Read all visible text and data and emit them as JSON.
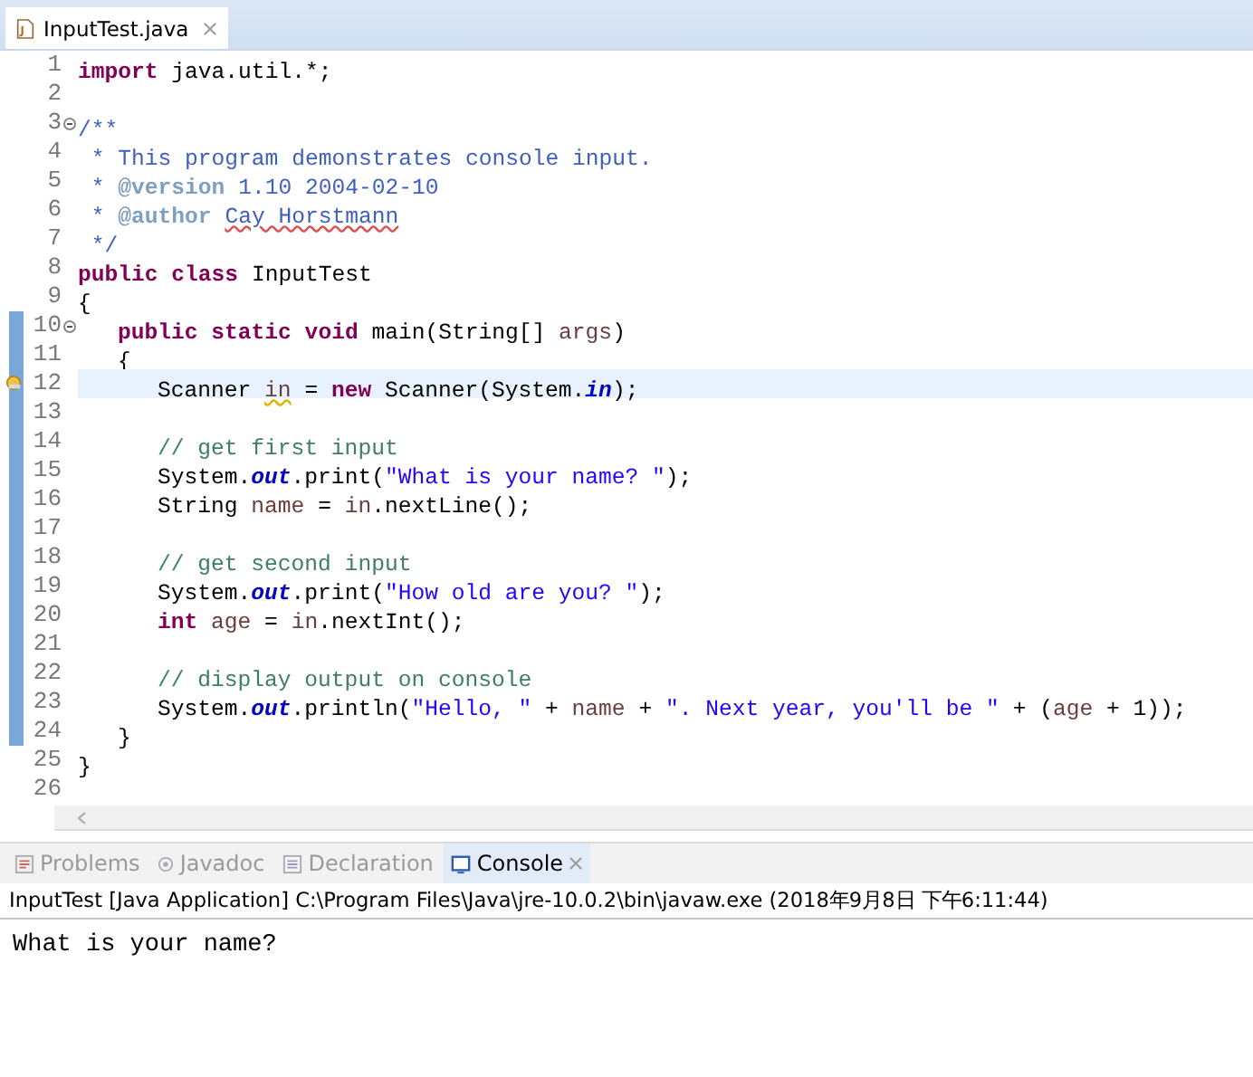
{
  "editor": {
    "tabs": [
      {
        "label": "InputTest.java",
        "selected": true
      }
    ],
    "lines": [
      {
        "number": "1",
        "fold": false,
        "range": false,
        "current": false,
        "warning": false,
        "tokens": [
          {
            "kind": "keyword",
            "text": "import"
          },
          {
            "kind": "plain",
            "text": " java.util.*;"
          }
        ]
      },
      {
        "number": "2",
        "fold": false,
        "range": false,
        "current": false,
        "warning": false
      },
      {
        "number": "3",
        "fold": true,
        "range": false,
        "current": false,
        "warning": false,
        "tokens": [
          {
            "kind": "doc",
            "text": "/**"
          }
        ]
      },
      {
        "number": "4",
        "fold": false,
        "range": false,
        "current": false,
        "warning": false,
        "tokens": [
          {
            "kind": "doc",
            "text": " * This program demonstrates console input."
          }
        ]
      },
      {
        "number": "5",
        "fold": false,
        "range": false,
        "current": false,
        "warning": false,
        "tokens": [
          {
            "kind": "doc",
            "text": " * "
          },
          {
            "kind": "doctag",
            "text": "@version"
          },
          {
            "kind": "doc",
            "text": " 1.10 2004-02-10"
          }
        ]
      },
      {
        "number": "6",
        "fold": false,
        "range": false,
        "current": false,
        "warning": false,
        "tokens": [
          {
            "kind": "doc",
            "text": " * "
          },
          {
            "kind": "doctag",
            "text": "@author "
          },
          {
            "kind": "doc_misspelled",
            "text": "Cay Horstmann"
          }
        ]
      },
      {
        "number": "7",
        "fold": false,
        "range": false,
        "current": false,
        "warning": false,
        "tokens": [
          {
            "kind": "doc",
            "text": " */"
          }
        ]
      },
      {
        "number": "8",
        "fold": false,
        "range": false,
        "current": false,
        "warning": false,
        "tokens": [
          {
            "kind": "keyword",
            "text": "public class"
          },
          {
            "kind": "plain",
            "text": " InputTest"
          }
        ]
      },
      {
        "number": "9",
        "fold": false,
        "range": false,
        "current": false,
        "warning": false,
        "tokens": [
          {
            "kind": "plain",
            "text": "{"
          }
        ]
      },
      {
        "number": "10",
        "fold": true,
        "range": true,
        "current": false,
        "warning": false,
        "tokens": [
          {
            "kind": "keyword",
            "text": "\tpublic static void"
          },
          {
            "kind": "plain",
            "text": " main(String[] "
          },
          {
            "kind": "local",
            "text": "args"
          },
          {
            "kind": "plain",
            "text": ")"
          }
        ]
      },
      {
        "number": "11",
        "fold": false,
        "range": true,
        "current": false,
        "warning": false,
        "tokens": [
          {
            "kind": "plain",
            "text": "\t{"
          }
        ]
      },
      {
        "number": "12",
        "fold": false,
        "range": true,
        "current": true,
        "warning": true,
        "tokens": [
          {
            "kind": "plain",
            "text": "\t\tScanner "
          },
          {
            "kind": "local_warning",
            "text": "in"
          },
          {
            "kind": "plain",
            "text": " = "
          },
          {
            "kind": "keyword",
            "text": "new"
          },
          {
            "kind": "plain",
            "text": " Scanner(System."
          },
          {
            "kind": "static",
            "text": "in"
          },
          {
            "kind": "plain",
            "text": ");"
          }
        ]
      },
      {
        "number": "13",
        "fold": false,
        "range": true,
        "current": false,
        "warning": false
      },
      {
        "number": "14",
        "fold": false,
        "range": true,
        "current": false,
        "warning": false,
        "tokens": [
          {
            "kind": "comment",
            "text": "\t\t// get first input"
          }
        ]
      },
      {
        "number": "15",
        "fold": false,
        "range": true,
        "current": false,
        "warning": false,
        "tokens": [
          {
            "kind": "plain",
            "text": "\t\tSystem."
          },
          {
            "kind": "static",
            "text": "out"
          },
          {
            "kind": "plain",
            "text": ".print("
          },
          {
            "kind": "string",
            "text": "\"What is your name? \""
          },
          {
            "kind": "plain",
            "text": ");"
          }
        ]
      },
      {
        "number": "16",
        "fold": false,
        "range": true,
        "current": false,
        "warning": false,
        "tokens": [
          {
            "kind": "plain",
            "text": "\t\tString "
          },
          {
            "kind": "local",
            "text": "name"
          },
          {
            "kind": "plain",
            "text": " = "
          },
          {
            "kind": "local",
            "text": "in"
          },
          {
            "kind": "plain",
            "text": ".nextLine();"
          }
        ]
      },
      {
        "number": "17",
        "fold": false,
        "range": true,
        "current": false,
        "warning": false
      },
      {
        "number": "18",
        "fold": false,
        "range": true,
        "current": false,
        "warning": false,
        "tokens": [
          {
            "kind": "comment",
            "text": "\t\t// get second input"
          }
        ]
      },
      {
        "number": "19",
        "fold": false,
        "range": true,
        "current": false,
        "warning": false,
        "tokens": [
          {
            "kind": "plain",
            "text": "\t\tSystem."
          },
          {
            "kind": "static",
            "text": "out"
          },
          {
            "kind": "plain",
            "text": ".print("
          },
          {
            "kind": "string",
            "text": "\"How old are you? \""
          },
          {
            "kind": "plain",
            "text": ");"
          }
        ]
      },
      {
        "number": "20",
        "fold": false,
        "range": true,
        "current": false,
        "warning": false,
        "tokens": [
          {
            "kind": "keyword",
            "text": "\t\tint "
          },
          {
            "kind": "local",
            "text": "age"
          },
          {
            "kind": "plain",
            "text": " = "
          },
          {
            "kind": "local",
            "text": "in"
          },
          {
            "kind": "plain",
            "text": ".nextInt();"
          }
        ]
      },
      {
        "number": "21",
        "fold": false,
        "range": true,
        "current": false,
        "warning": false
      },
      {
        "number": "22",
        "fold": false,
        "range": true,
        "current": false,
        "warning": false,
        "tokens": [
          {
            "kind": "comment",
            "text": "\t\t// display output on console"
          }
        ]
      },
      {
        "number": "23",
        "fold": false,
        "range": true,
        "current": false,
        "warning": false,
        "tokens": [
          {
            "kind": "plain",
            "text": "\t\tSystem."
          },
          {
            "kind": "static",
            "text": "out"
          },
          {
            "kind": "plain",
            "text": ".println("
          },
          {
            "kind": "string",
            "text": "\"Hello, \""
          },
          {
            "kind": "plain",
            "text": " + "
          },
          {
            "kind": "local",
            "text": "name"
          },
          {
            "kind": "plain",
            "text": " + "
          },
          {
            "kind": "string",
            "text": "\". Next year, you'll be \""
          },
          {
            "kind": "plain",
            "text": " + ("
          },
          {
            "kind": "local",
            "text": "age"
          },
          {
            "kind": "plain",
            "text": " + 1));"
          }
        ]
      },
      {
        "number": "24",
        "fold": false,
        "range": true,
        "current": false,
        "warning": false,
        "tokens": [
          {
            "kind": "plain",
            "text": "\t}"
          }
        ]
      },
      {
        "number": "25",
        "fold": false,
        "range": false,
        "current": false,
        "warning": false,
        "tokens": [
          {
            "kind": "plain",
            "text": "}"
          }
        ]
      },
      {
        "number": "26",
        "fold": false,
        "range": false,
        "current": false,
        "warning": false
      }
    ]
  },
  "panel": {
    "tabs": [
      {
        "label": "Problems",
        "kind": "problems",
        "selected": false
      },
      {
        "label": "Javadoc",
        "kind": "javadoc",
        "selected": false
      },
      {
        "label": "Declaration",
        "kind": "declaration",
        "selected": false
      },
      {
        "label": "Console",
        "kind": "console",
        "selected": true
      }
    ],
    "console_header": "InputTest [Java Application] C:\\Program Files\\Java\\jre-10.0.2\\bin\\javaw.exe (2018年9月8日 下午6:11:44)",
    "console_output": "What is your name?"
  }
}
